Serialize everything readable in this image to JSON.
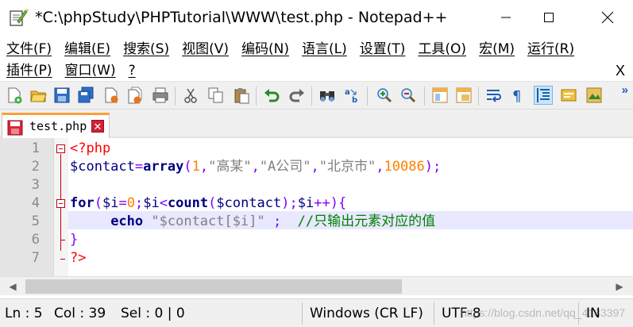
{
  "window": {
    "title": "*C:\\phpStudy\\PHPTutorial\\WWW\\test.php - Notepad++"
  },
  "menu": {
    "row1": [
      "文件(F)",
      "编辑(E)",
      "搜索(S)",
      "视图(V)",
      "编码(N)",
      "语言(L)",
      "设置(T)",
      "工具(O)",
      "宏(M)",
      "运行(R)"
    ],
    "row2": [
      "插件(P)",
      "窗口(W)",
      "?"
    ],
    "close_label": "X"
  },
  "toolbar": {
    "icons": [
      "new-file-icon",
      "open-file-icon",
      "save-icon",
      "save-all-icon",
      "close-icon",
      "close-all-icon",
      "print-icon",
      "cut-icon",
      "copy-icon",
      "paste-icon",
      "undo-icon",
      "redo-icon",
      "find-icon",
      "replace-icon",
      "zoom-in-icon",
      "zoom-out-icon",
      "sync-vertical-icon",
      "sync-horizontal-icon",
      "word-wrap-icon",
      "show-all-chars-icon",
      "indent-guide-icon",
      "udl-icon",
      "doc-map-icon"
    ],
    "more_label": "»"
  },
  "tab": {
    "label": "test.php",
    "close_glyph": "✕"
  },
  "editor": {
    "line_numbers": [
      "1",
      "2",
      "3",
      "4",
      "5",
      "6",
      "7"
    ],
    "current_line": 5,
    "lines": [
      [
        {
          "t": "<?php",
          "c": "php-tag"
        }
      ],
      [
        {
          "t": "$contact",
          "c": "var"
        },
        {
          "t": "=",
          "c": "op"
        },
        {
          "t": "array",
          "c": "fn"
        },
        {
          "t": "(",
          "c": "op"
        },
        {
          "t": "1",
          "c": "num"
        },
        {
          "t": ",",
          "c": "op"
        },
        {
          "t": "\"高某\"",
          "c": "str"
        },
        {
          "t": ",",
          "c": "op"
        },
        {
          "t": "\"A公司\"",
          "c": "str"
        },
        {
          "t": ",",
          "c": "op"
        },
        {
          "t": "\"北京市\"",
          "c": "str"
        },
        {
          "t": ",",
          "c": "op"
        },
        {
          "t": "10086",
          "c": "num"
        },
        {
          "t": ");",
          "c": "op"
        }
      ],
      [],
      [
        {
          "t": "for",
          "c": "kw"
        },
        {
          "t": "(",
          "c": "op"
        },
        {
          "t": "$i",
          "c": "var"
        },
        {
          "t": "=",
          "c": "op"
        },
        {
          "t": "0",
          "c": "num"
        },
        {
          "t": ";",
          "c": "op"
        },
        {
          "t": "$i",
          "c": "var"
        },
        {
          "t": "<",
          "c": "op"
        },
        {
          "t": "count",
          "c": "fn"
        },
        {
          "t": "(",
          "c": "op"
        },
        {
          "t": "$contact",
          "c": "var"
        },
        {
          "t": ");",
          "c": "op"
        },
        {
          "t": "$i",
          "c": "var"
        },
        {
          "t": "++){",
          "c": "op"
        }
      ],
      [
        {
          "t": "     ",
          "c": "plain"
        },
        {
          "t": "echo",
          "c": "kw"
        },
        {
          "t": " ",
          "c": "plain"
        },
        {
          "t": "\"$contact[$i]\"",
          "c": "str"
        },
        {
          "t": " ",
          "c": "plain"
        },
        {
          "t": ";",
          "c": "op"
        },
        {
          "t": "  ",
          "c": "plain"
        },
        {
          "t": "//只输出元素对应的值",
          "c": "cmt"
        }
      ],
      [
        {
          "t": "}",
          "c": "op"
        }
      ],
      [
        {
          "t": "?>",
          "c": "php-tag"
        }
      ]
    ]
  },
  "statusbar": {
    "line": "Ln : 5",
    "col": "Col : 39",
    "sel": "Sel : 0 | 0",
    "eol": "Windows (CR LF)",
    "encoding": "UTF-8",
    "mode": "IN",
    "watermark": "https://blog.csdn.net/qq_4183397"
  },
  "colors": {
    "php_tag": "#ff0000",
    "variable": "#000080",
    "operator": "#8000ff",
    "number": "#ff8000",
    "string": "#808080",
    "comment": "#008000",
    "current_line": "#e8e8ff",
    "tab_accent": "#f6a23a"
  }
}
